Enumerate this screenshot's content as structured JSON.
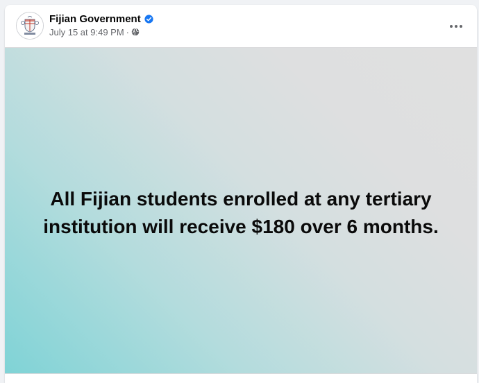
{
  "post": {
    "page_name": "Fijian Government",
    "verified": true,
    "timestamp": "July 15 at 9:49 PM",
    "separator": "·",
    "audience_icon": "globe-icon",
    "more_icon": "more-options-icon",
    "avatar_icon": "fiji-coat-of-arms-logo",
    "background_colors": [
      "#7fd3d6",
      "#dedfe0"
    ],
    "text": "All Fijian students enrolled at any tertiary institution will receive $180 over 6 months."
  },
  "colors": {
    "verified_badge": "#1877f2",
    "secondary_text": "#65676b",
    "primary_text": "#050505"
  }
}
